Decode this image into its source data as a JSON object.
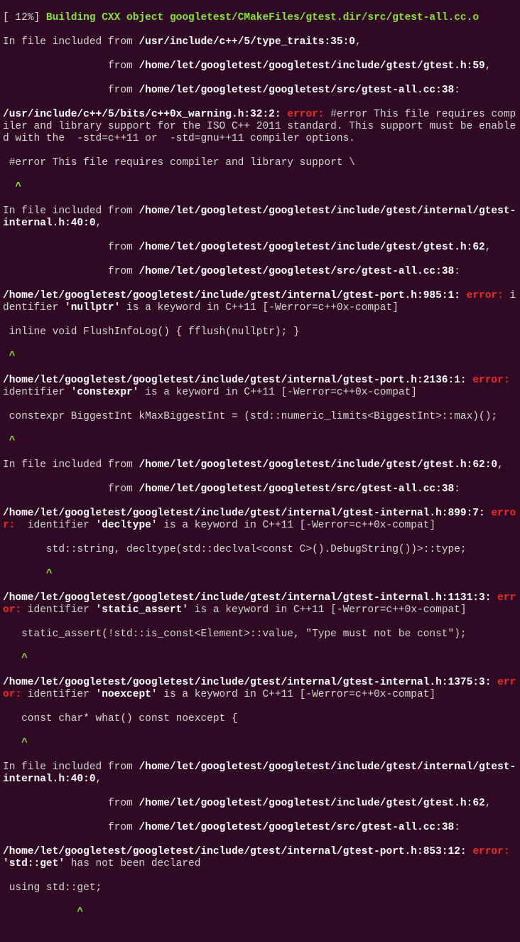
{
  "progress": "[ 12%] ",
  "build_msg": "Building CXX object googletest/CMakeFiles/gtest.dir/src/gtest-all.cc.o",
  "include_from": "In file included from ",
  "from_pad1": "                 from ",
  "from_pad2": "                 from ",
  "f": {
    "type_traits": "/usr/include/c++/5/type_traits:35:0",
    "gtest_h_59": "/home/let/googletest/googletest/include/gtest/gtest.h:59",
    "gtest_all_38": "/home/let/googletest/googletest/src/gtest-all.cc:38",
    "cxx0x_warn": "/usr/include/c++/5/bits/c++0x_warning.h:32:2:",
    "internal_40": "/home/let/googletest/googletest/include/gtest/internal/gtest-internal.h:40:0",
    "gtest_h_62": "/home/let/googletest/googletest/include/gtest/gtest.h:62",
    "gtest_h_62_0": "/home/let/googletest/googletest/include/gtest/gtest.h:62:0",
    "port_985": "/home/let/googletest/googletest/include/gtest/internal/gtest-port.h:985:1:",
    "port_2136": "/home/let/googletest/googletest/include/gtest/internal/gtest-port.h:2136:1:",
    "internal_899": "/home/let/googletest/googletest/include/gtest/internal/gtest-internal.h:899:7:",
    "internal_1131": "/home/let/googletest/googletest/include/gtest/internal/gtest-internal.h:1131:3:",
    "internal_1375": "/home/let/googletest/googletest/include/gtest/internal/gtest-internal.h:1375:3:",
    "port_853": "/home/let/googletest/googletest/include/gtest/internal/gtest-port.h:853:12:"
  },
  "err": {
    "error": "error:",
    "msg_cpp11": "#error This file requires compiler and library support for the ISO C++ 2011 standard. This support must be enabled with the  -std=c++11 or  -std=gnu++11 compiler options.",
    "ctx_cpp11": " #error This file requires compiler and library support \\",
    "caret1": "  ^",
    "id_pre1": " identifier ",
    "id_pre2": " identifier ",
    "id_pre3": "  identifier ",
    "nullptr": "'nullptr'",
    "constexpr": "'constexpr'",
    "decltype": "'decltype'",
    "static_assert": "'static_assert'",
    "noexcept": "'noexcept'",
    "std_get": "'std::get'",
    "kw_suffix": " is a keyword in C++11 [-Werror=c++0x-compat]",
    "ctx_nullptr": " inline void FlushInfoLog() { fflush(nullptr); }",
    "caret_nullptr": " ^",
    "ctx_constexpr": " constexpr BiggestInt kMaxBiggestInt = (std::numeric_limits<BiggestInt>::max)();",
    "caret_constexpr": " ^",
    "ctx_decltype": "       std::string, decltype(std::declval<const C>().DebugString())>::type;",
    "caret_decltype": "       ^",
    "ctx_static": "   static_assert(!std::is_const<Element>::value, \"Type must not be const\");",
    "caret_static": "   ^",
    "ctx_noexcept": "   const char* what() const noexcept {",
    "caret_noexcept": "   ^",
    "not_declared": " has not been declared",
    "ctx_using": " using std::get;",
    "caret_using": "            ^"
  },
  "comma": ",",
  "colon": ":"
}
